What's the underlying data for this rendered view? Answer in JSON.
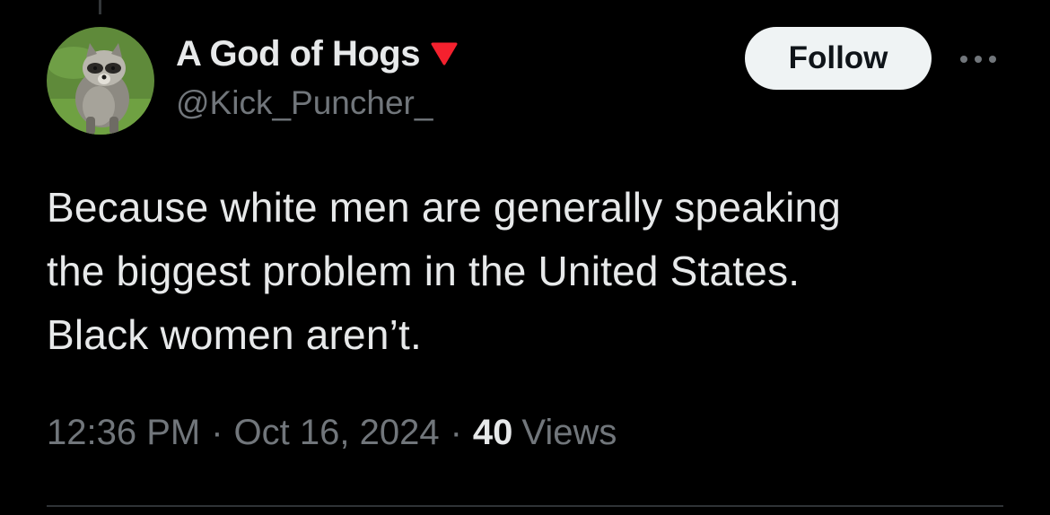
{
  "user": {
    "display_name": "A God of Hogs",
    "handle": "@Kick_Puncher_",
    "badge_icon": "red-down-triangle-icon",
    "badge_color": "#f4212e",
    "avatar": "raccoon-avatar"
  },
  "actions": {
    "follow_label": "Follow",
    "more_icon": "more-options-icon"
  },
  "tweet": {
    "text": "Because white men are generally speaking\nthe biggest problem in the United States.\nBlack women aren’t.",
    "time": "12:36 PM",
    "separator": "·",
    "date": "Oct 16, 2024",
    "views_count": "40",
    "views_label": "Views"
  },
  "colors": {
    "background": "#000000",
    "primary_text": "#e7e9ea",
    "secondary_text": "#71767b",
    "follow_button_bg": "#eff3f4",
    "divider": "#2f3336"
  }
}
